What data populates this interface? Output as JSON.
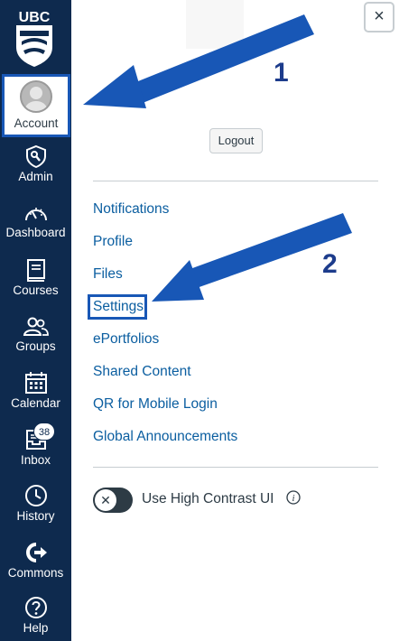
{
  "sidebar": {
    "logo_text": "UBC",
    "account_label": "Account",
    "items": [
      {
        "label": "Admin",
        "icon": "admin-shield-icon"
      },
      {
        "label": "Dashboard",
        "icon": "dashboard-gauge-icon"
      },
      {
        "label": "Courses",
        "icon": "courses-book-icon"
      },
      {
        "label": "Groups",
        "icon": "groups-people-icon"
      },
      {
        "label": "Calendar",
        "icon": "calendar-icon"
      },
      {
        "label": "Inbox",
        "icon": "inbox-icon"
      },
      {
        "label": "History",
        "icon": "history-clock-icon"
      },
      {
        "label": "Commons",
        "icon": "commons-share-icon"
      },
      {
        "label": "Help",
        "icon": "help-question-icon"
      }
    ],
    "inbox_badge": "38"
  },
  "tray": {
    "close_glyph": "×",
    "logout_label": "Logout",
    "links": [
      "Notifications",
      "Profile",
      "Files",
      "Settings",
      "ePortfolios",
      "Shared Content",
      "QR for Mobile Login",
      "Global Announcements"
    ],
    "toggle_glyph": "✕",
    "high_contrast_label": "Use High Contrast UI",
    "info_glyph": "i"
  },
  "annotations": {
    "step1": "1",
    "step2": "2"
  },
  "colors": {
    "sidebar_bg": "#0e2a4e",
    "link": "#0b5ea0",
    "annotation_blue": "#1857b6"
  }
}
